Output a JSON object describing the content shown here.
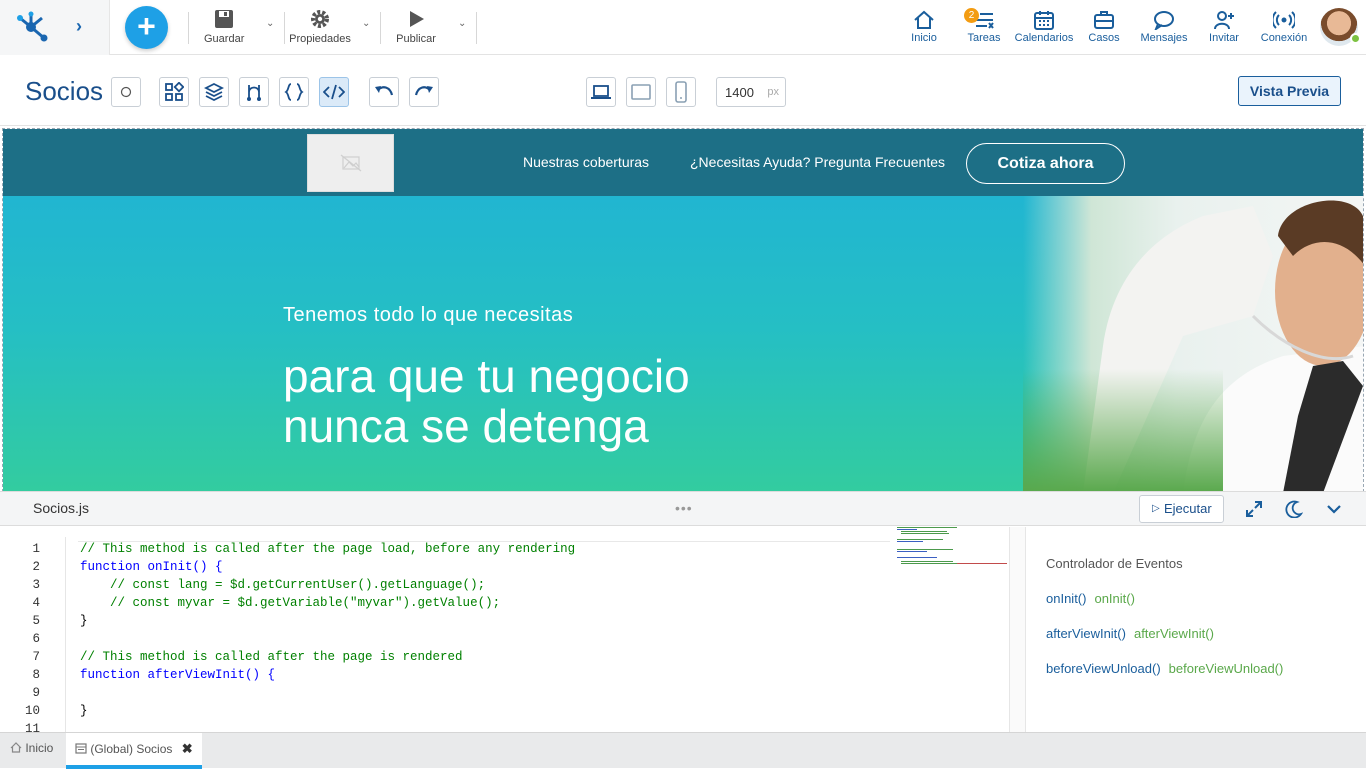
{
  "topbar": {
    "guardar": "Guardar",
    "propiedades": "Propiedades",
    "publicar": "Publicar",
    "nav": {
      "inicio": "Inicio",
      "tareas": "Tareas",
      "tareas_badge": "2",
      "calendarios": "Calendarios",
      "casos": "Casos",
      "mensajes": "Mensajes",
      "invitar": "Invitar",
      "conexion": "Conexión"
    },
    "accent": "#1ea0e6"
  },
  "toolbar": {
    "title": "Socios",
    "width_value": "1400",
    "width_unit": "px",
    "preview": "Vista Previa"
  },
  "hero": {
    "link1": "Nuestras coberturas",
    "link2": "¿Necesitas Ayuda? Pregunta Frecuentes",
    "cta": "Cotiza ahora",
    "subtitle": "Tenemos todo lo que necesitas",
    "headline1": "para que tu negocio",
    "headline2": "nunca se detenga"
  },
  "editor": {
    "file": "Socios.js",
    "run": "Ejecutar",
    "lines": [
      {
        "n": "1",
        "text": "// This method is called after the page load, before any rendering"
      },
      {
        "n": "2",
        "text": "function onInit() {"
      },
      {
        "n": "3",
        "text": "    // const lang = $d.getCurrentUser().getLanguage();"
      },
      {
        "n": "4",
        "text": "    // const myvar = $d.getVariable(\"myvar\").getValue();"
      },
      {
        "n": "5",
        "text": "}"
      },
      {
        "n": "6",
        "text": ""
      },
      {
        "n": "7",
        "text": "// This method is called after the page is rendered"
      },
      {
        "n": "8",
        "text": "function afterViewInit() {"
      },
      {
        "n": "9",
        "text": ""
      },
      {
        "n": "10",
        "text": "}"
      },
      {
        "n": "11",
        "text": ""
      }
    ]
  },
  "events": {
    "title": "Controlador de Eventos",
    "items": [
      {
        "a": "onInit()",
        "b": "onInit()"
      },
      {
        "a": "afterViewInit()",
        "b": "afterViewInit()"
      },
      {
        "a": "beforeViewUnload()",
        "b": "beforeViewUnload()"
      }
    ]
  },
  "bottom": {
    "tab1": "Inicio",
    "tab2": "(Global) Socios"
  }
}
